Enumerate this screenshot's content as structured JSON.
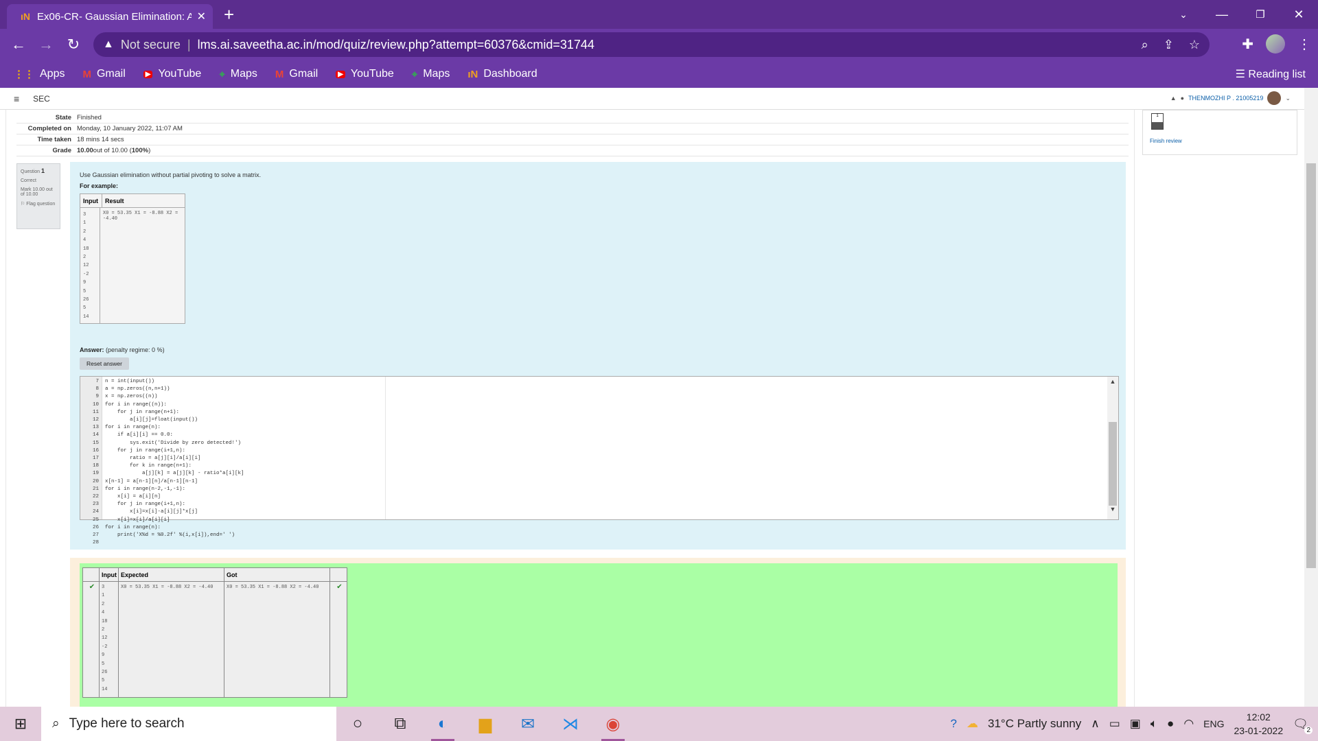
{
  "browser": {
    "tab_title": "Ex06-CR- Gaussian Elimination: A",
    "favicon_text": "ıN",
    "url_warning": "Not secure",
    "url": "lms.ai.saveetha.ac.in/mod/quiz/review.php?attempt=60376&cmid=31744",
    "bookmarks": [
      {
        "label": "Apps",
        "icon": "apps-icon"
      },
      {
        "label": "Gmail",
        "icon": "gmail-icon"
      },
      {
        "label": "YouTube",
        "icon": "youtube-icon"
      },
      {
        "label": "Maps",
        "icon": "maps-icon"
      },
      {
        "label": "Gmail",
        "icon": "gmail-icon"
      },
      {
        "label": "YouTube",
        "icon": "youtube-icon"
      },
      {
        "label": "Maps",
        "icon": "maps-icon"
      },
      {
        "label": "Dashboard",
        "icon": "moodle-icon"
      }
    ],
    "reading_list": "Reading list"
  },
  "site": {
    "course": "SEC",
    "user_name": "THENMOZHI P . 21005219"
  },
  "summary": [
    {
      "key": "State",
      "value": "Finished"
    },
    {
      "key": "Completed on",
      "value": "Monday, 10 January 2022, 11:07 AM"
    },
    {
      "key": "Time taken",
      "value": "18 mins 14 secs"
    },
    {
      "key": "Grade",
      "value_bold": "10.00",
      "value": " out of 10.00 (",
      "value_pct": "100%",
      "value_end": ")"
    }
  ],
  "question": {
    "label": "Question",
    "number": "1",
    "status": "Correct",
    "mark": "Mark 10.00 out of 10.00",
    "flag": "Flag question",
    "text": "Use Gaussian elimination without partial pivoting to solve a matrix.",
    "for_example": "For example:",
    "example_headers": [
      "Input",
      "Result"
    ],
    "example_input": [
      "3",
      "1",
      "2",
      "4",
      "18",
      "2",
      "12",
      "-2",
      "9",
      "5",
      "26",
      "5",
      "14"
    ],
    "example_result": "X0 = 53.35 X1 = -8.88 X2 = -4.40",
    "answer_label": "Answer:",
    "penalty": "(penalty regime: 0 %)",
    "reset_label": "Reset answer"
  },
  "code_lines": [
    {
      "n": "7",
      "t": "n = int(input())"
    },
    {
      "n": "8",
      "t": "a = np.zeros((n,n+1))"
    },
    {
      "n": "9",
      "t": "x = np.zeros((n))"
    },
    {
      "n": "10",
      "t": "for i in range((n)):"
    },
    {
      "n": "11",
      "t": "    for j in range(n+1):"
    },
    {
      "n": "12",
      "t": "        a[i][j]=float(input())"
    },
    {
      "n": "13",
      "t": "for i in range(n):"
    },
    {
      "n": "14",
      "t": "    if a[i][i] == 0.0:"
    },
    {
      "n": "15",
      "t": "        sys.exit('Divide by zero detected!')"
    },
    {
      "n": "16",
      "t": "    for j in range(i+1,n):"
    },
    {
      "n": "17",
      "t": "        ratio = a[j][i]/a[i][i]"
    },
    {
      "n": "18",
      "t": "        for k in range(n+1):"
    },
    {
      "n": "19",
      "t": "            a[j][k] = a[j][k] - ratio*a[i][k]"
    },
    {
      "n": "20",
      "t": "x[n-1] = a[n-1][n]/a[n-1][n-1]"
    },
    {
      "n": "21",
      "t": "for i in range(n-2,-1,-1):"
    },
    {
      "n": "22",
      "t": "    x[i] = a[i][n]"
    },
    {
      "n": "23",
      "t": "    for j in range(i+1,n):"
    },
    {
      "n": "24",
      "t": "        x[i]=x[i]-a[i][j]*x[j]"
    },
    {
      "n": "25",
      "t": "    x[i]=x[i]/a[i][i]"
    },
    {
      "n": "26",
      "t": "for i in range(n):"
    },
    {
      "n": "27",
      "t": "    print('X%d = %0.2f' %(i,x[i]),end=' ')"
    },
    {
      "n": "28",
      "t": ""
    }
  ],
  "results": {
    "headers": [
      "Input",
      "Expected",
      "Got"
    ],
    "expected": "X0 = 53.35 X1 = -8.88 X2 = -4.40",
    "got": "X0 = 53.35 X1 = -8.88 X2 = -4.40"
  },
  "nav": {
    "box_number": "1",
    "finish_review": "Finish review"
  },
  "taskbar": {
    "search_placeholder": "Type here to search",
    "weather": "31°C  Partly sunny",
    "language": "ENG",
    "time": "12:02",
    "date": "23-01-2022",
    "notifications": "2"
  }
}
